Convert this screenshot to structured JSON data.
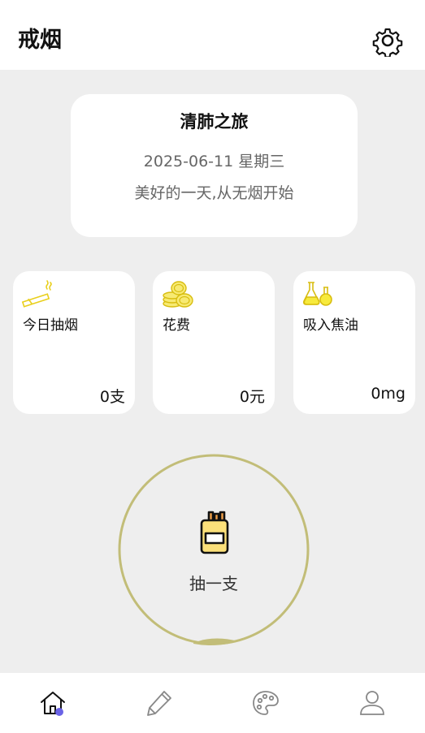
{
  "header": {
    "title": "戒烟",
    "settings_icon": "gear-icon"
  },
  "hero": {
    "title": "清肺之旅",
    "date": "2025-06-11 星期三",
    "slogan": "美好的一天,从无烟开始"
  },
  "stats": [
    {
      "icon": "cigarette-icon",
      "label": "今日抽烟",
      "value": "0支"
    },
    {
      "icon": "coins-icon",
      "label": "花费",
      "value": "0元"
    },
    {
      "icon": "flask-icon",
      "label": "吸入焦油",
      "value": "0mg"
    }
  ],
  "smoke_button": {
    "label": "抽一支",
    "icon": "cigarette-pack-icon"
  },
  "nav": [
    {
      "icon": "home-icon",
      "active": true
    },
    {
      "icon": "pencil-icon",
      "active": false
    },
    {
      "icon": "palette-icon",
      "active": false
    },
    {
      "icon": "user-icon",
      "active": false
    }
  ],
  "colors": {
    "accent_yellow": "#f5dc3c",
    "ring": "#c2bd78",
    "nav_active_dot": "#6a63e6",
    "background": "#eeeeee"
  }
}
